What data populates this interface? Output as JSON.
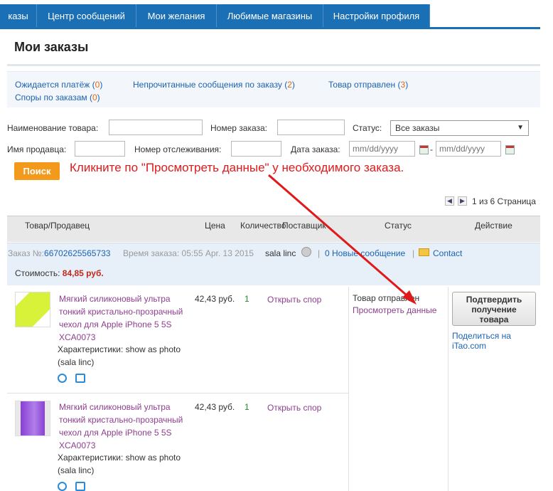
{
  "nav": {
    "tabs": [
      "казы",
      "Центр сообщений",
      "Мои желания",
      "Любимые магазины",
      "Настройки профиля"
    ]
  },
  "page_title": "Мои заказы",
  "summary": {
    "awaiting_payment_label": "Ожидается платёж",
    "awaiting_payment_count": "0",
    "unread_messages_label": "Непрочитанные сообщения по заказу",
    "unread_messages_count": "2",
    "shipped_label": "Товар отправлен",
    "shipped_count": "3",
    "disputes_label": "Споры по заказам",
    "disputes_count": "0",
    "open_paren": "(",
    "close_paren": ")"
  },
  "filters": {
    "product_name_label": "Наименование товара:",
    "order_number_label": "Номер заказа:",
    "status_label": "Статус:",
    "status_value": "Все заказы",
    "seller_label": "Имя продавца:",
    "tracking_label": "Номер отслеживания:",
    "date_label": "Дата заказа:",
    "date_from_placeholder": "mm/dd/yyyy",
    "date_to_placeholder": "mm/dd/yyyy",
    "date_dash": "-",
    "search_button": "Поиск"
  },
  "annotation": "Кликните по \"Просмотреть данные\" у необходимого заказа.",
  "pagination": {
    "text": "1 из 6 Страница"
  },
  "table_headers": {
    "product": "Товар/Продавец",
    "price": "Цена",
    "qty": "Количество",
    "supplier": "Поставщик",
    "status": "Статус",
    "action": "Действие"
  },
  "order": {
    "number_label": "Заказ №:",
    "number": "66702625565733",
    "time_label": "Время заказа:",
    "time": "05:55 Apr. 13 2015",
    "seller": "sala linc",
    "sep": "|",
    "new_messages": "0 Новые сообщение",
    "contact": "Contact",
    "cost_label": "Стоимость:",
    "cost": "84,85 руб."
  },
  "items": [
    {
      "title_lines": [
        "Мягкий силиконовый ультра",
        "тонкий кристально-прозрачный",
        "чехол для Apple iPhone 5 5S",
        "XCA0073"
      ],
      "specs": "Характеристики: show as photo",
      "seller": "(sala linc)",
      "price": "42,43 руб.",
      "qty": "1",
      "dispute": "Открыть спор",
      "thumb_color": "#d8f23a"
    },
    {
      "title_lines": [
        "Мягкий силиконовый ультра",
        "тонкий кристально-прозрачный",
        "чехол для Apple iPhone 5 5S",
        "XCA0073"
      ],
      "specs": "Характеристики: show as photo",
      "seller": "(sala linc)",
      "price": "42,43 руб.",
      "qty": "1",
      "dispute": "Открыть спор",
      "thumb_color": "#8a3fd6"
    }
  ],
  "status": {
    "text": "Товар отправлен",
    "view_details": "Просмотреть данные"
  },
  "actions": {
    "confirm_line1": "Подтвердить",
    "confirm_line2": "получение",
    "confirm_line3": "товара",
    "share_line1": "Поделиться на",
    "share_line2": "iTao.com"
  },
  "colors": {
    "nav_blue": "#1a6fb5",
    "accent_orange": "#f39a1c",
    "arrow_red": "#e0191b",
    "link_blue": "#1b62b3",
    "product_link": "#8e3f8e"
  }
}
